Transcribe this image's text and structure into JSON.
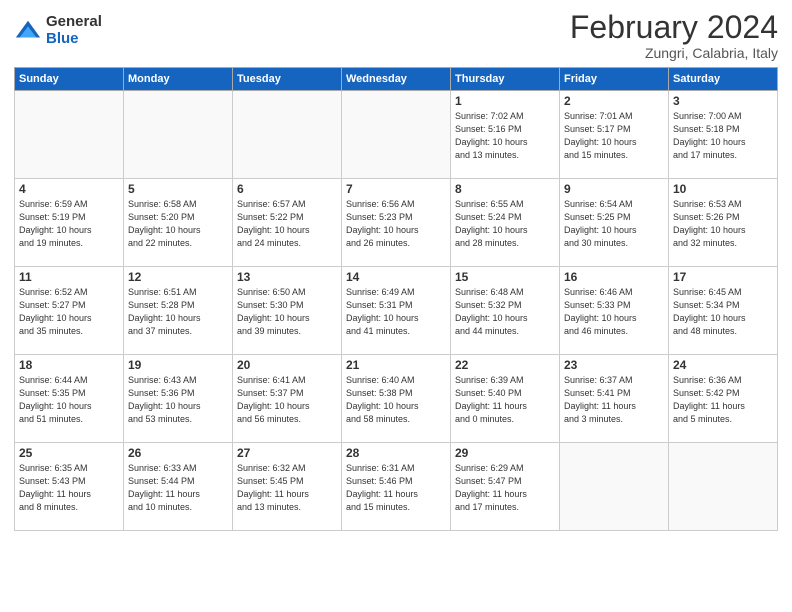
{
  "logo": {
    "general": "General",
    "blue": "Blue"
  },
  "header": {
    "title": "February 2024",
    "subtitle": "Zungri, Calabria, Italy"
  },
  "columns": [
    "Sunday",
    "Monday",
    "Tuesday",
    "Wednesday",
    "Thursday",
    "Friday",
    "Saturday"
  ],
  "weeks": [
    [
      {
        "day": "",
        "info": ""
      },
      {
        "day": "",
        "info": ""
      },
      {
        "day": "",
        "info": ""
      },
      {
        "day": "",
        "info": ""
      },
      {
        "day": "1",
        "info": "Sunrise: 7:02 AM\nSunset: 5:16 PM\nDaylight: 10 hours\nand 13 minutes."
      },
      {
        "day": "2",
        "info": "Sunrise: 7:01 AM\nSunset: 5:17 PM\nDaylight: 10 hours\nand 15 minutes."
      },
      {
        "day": "3",
        "info": "Sunrise: 7:00 AM\nSunset: 5:18 PM\nDaylight: 10 hours\nand 17 minutes."
      }
    ],
    [
      {
        "day": "4",
        "info": "Sunrise: 6:59 AM\nSunset: 5:19 PM\nDaylight: 10 hours\nand 19 minutes."
      },
      {
        "day": "5",
        "info": "Sunrise: 6:58 AM\nSunset: 5:20 PM\nDaylight: 10 hours\nand 22 minutes."
      },
      {
        "day": "6",
        "info": "Sunrise: 6:57 AM\nSunset: 5:22 PM\nDaylight: 10 hours\nand 24 minutes."
      },
      {
        "day": "7",
        "info": "Sunrise: 6:56 AM\nSunset: 5:23 PM\nDaylight: 10 hours\nand 26 minutes."
      },
      {
        "day": "8",
        "info": "Sunrise: 6:55 AM\nSunset: 5:24 PM\nDaylight: 10 hours\nand 28 minutes."
      },
      {
        "day": "9",
        "info": "Sunrise: 6:54 AM\nSunset: 5:25 PM\nDaylight: 10 hours\nand 30 minutes."
      },
      {
        "day": "10",
        "info": "Sunrise: 6:53 AM\nSunset: 5:26 PM\nDaylight: 10 hours\nand 32 minutes."
      }
    ],
    [
      {
        "day": "11",
        "info": "Sunrise: 6:52 AM\nSunset: 5:27 PM\nDaylight: 10 hours\nand 35 minutes."
      },
      {
        "day": "12",
        "info": "Sunrise: 6:51 AM\nSunset: 5:28 PM\nDaylight: 10 hours\nand 37 minutes."
      },
      {
        "day": "13",
        "info": "Sunrise: 6:50 AM\nSunset: 5:30 PM\nDaylight: 10 hours\nand 39 minutes."
      },
      {
        "day": "14",
        "info": "Sunrise: 6:49 AM\nSunset: 5:31 PM\nDaylight: 10 hours\nand 41 minutes."
      },
      {
        "day": "15",
        "info": "Sunrise: 6:48 AM\nSunset: 5:32 PM\nDaylight: 10 hours\nand 44 minutes."
      },
      {
        "day": "16",
        "info": "Sunrise: 6:46 AM\nSunset: 5:33 PM\nDaylight: 10 hours\nand 46 minutes."
      },
      {
        "day": "17",
        "info": "Sunrise: 6:45 AM\nSunset: 5:34 PM\nDaylight: 10 hours\nand 48 minutes."
      }
    ],
    [
      {
        "day": "18",
        "info": "Sunrise: 6:44 AM\nSunset: 5:35 PM\nDaylight: 10 hours\nand 51 minutes."
      },
      {
        "day": "19",
        "info": "Sunrise: 6:43 AM\nSunset: 5:36 PM\nDaylight: 10 hours\nand 53 minutes."
      },
      {
        "day": "20",
        "info": "Sunrise: 6:41 AM\nSunset: 5:37 PM\nDaylight: 10 hours\nand 56 minutes."
      },
      {
        "day": "21",
        "info": "Sunrise: 6:40 AM\nSunset: 5:38 PM\nDaylight: 10 hours\nand 58 minutes."
      },
      {
        "day": "22",
        "info": "Sunrise: 6:39 AM\nSunset: 5:40 PM\nDaylight: 11 hours\nand 0 minutes."
      },
      {
        "day": "23",
        "info": "Sunrise: 6:37 AM\nSunset: 5:41 PM\nDaylight: 11 hours\nand 3 minutes."
      },
      {
        "day": "24",
        "info": "Sunrise: 6:36 AM\nSunset: 5:42 PM\nDaylight: 11 hours\nand 5 minutes."
      }
    ],
    [
      {
        "day": "25",
        "info": "Sunrise: 6:35 AM\nSunset: 5:43 PM\nDaylight: 11 hours\nand 8 minutes."
      },
      {
        "day": "26",
        "info": "Sunrise: 6:33 AM\nSunset: 5:44 PM\nDaylight: 11 hours\nand 10 minutes."
      },
      {
        "day": "27",
        "info": "Sunrise: 6:32 AM\nSunset: 5:45 PM\nDaylight: 11 hours\nand 13 minutes."
      },
      {
        "day": "28",
        "info": "Sunrise: 6:31 AM\nSunset: 5:46 PM\nDaylight: 11 hours\nand 15 minutes."
      },
      {
        "day": "29",
        "info": "Sunrise: 6:29 AM\nSunset: 5:47 PM\nDaylight: 11 hours\nand 17 minutes."
      },
      {
        "day": "",
        "info": ""
      },
      {
        "day": "",
        "info": ""
      }
    ]
  ]
}
